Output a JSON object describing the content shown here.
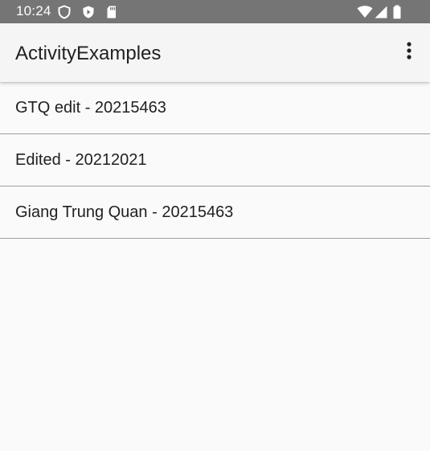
{
  "status_bar": {
    "time": "10:24",
    "background": "#757575",
    "icons_left": [
      "vpn-shield-icon",
      "play-protect-icon",
      "sd-card-icon"
    ],
    "icons_right": [
      "wifi-icon",
      "cellular-signal-icon",
      "battery-icon"
    ]
  },
  "app_bar": {
    "title": "ActivityExamples",
    "overflow_icon": "more-vert-icon"
  },
  "list": {
    "items": [
      {
        "label": "GTQ edit - 20215463"
      },
      {
        "label": "Edited - 20212021"
      },
      {
        "label": "Giang Trung Quan - 20215463"
      }
    ]
  },
  "colors": {
    "text_primary": "#212121",
    "divider": "#9e9e9e",
    "app_bar_bg": "#f5f5f5",
    "window_bg": "#fafafa"
  }
}
